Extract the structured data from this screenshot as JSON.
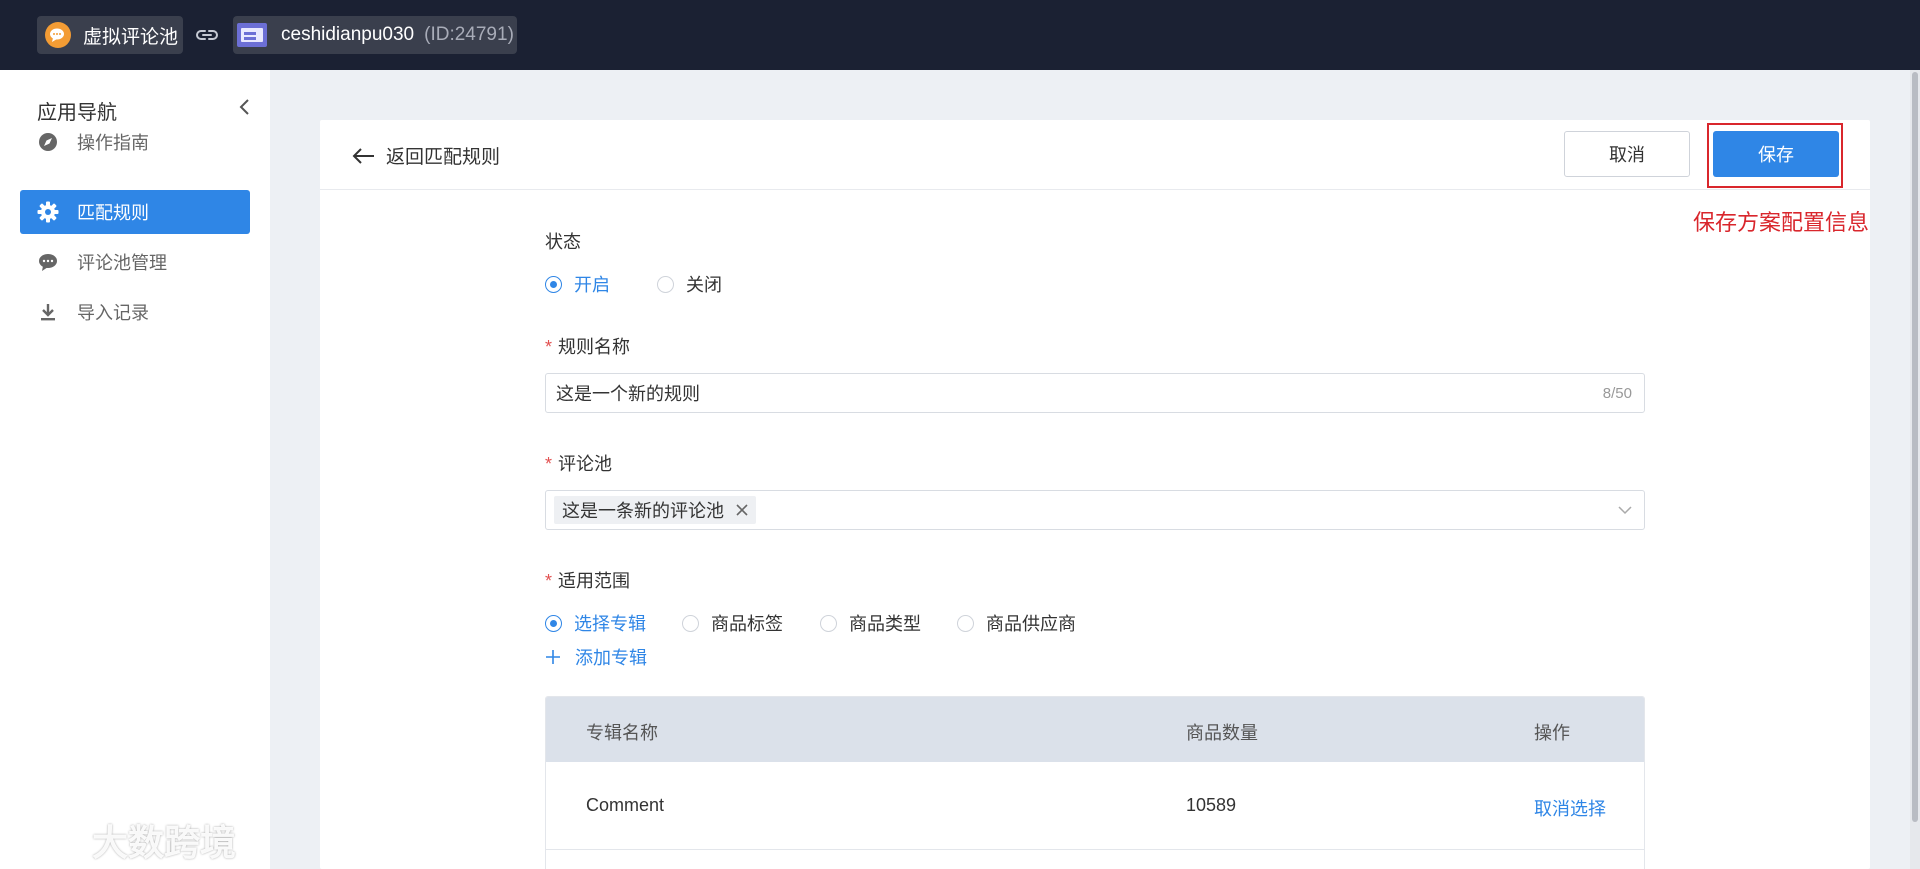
{
  "topbar": {
    "app_name": "虚拟评论池",
    "shop_name": "ceshidianpu030",
    "shop_id": "(ID:24791)"
  },
  "sidebar": {
    "title": "应用导航",
    "items": [
      {
        "label": "操作指南",
        "icon": "compass-icon",
        "active": false
      },
      {
        "label": "匹配规则",
        "icon": "gear-icon",
        "active": true
      },
      {
        "label": "评论池管理",
        "icon": "chat-icon",
        "active": false
      },
      {
        "label": "导入记录",
        "icon": "download-icon",
        "active": false
      }
    ]
  },
  "header": {
    "back_label": "返回匹配规则",
    "cancel_label": "取消",
    "save_label": "保存",
    "annotation": "保存方案配置信息"
  },
  "form": {
    "status": {
      "label": "状态",
      "options": [
        "开启",
        "关闭"
      ],
      "selected": "开启"
    },
    "rule_name": {
      "label": "规则名称",
      "value": "这是一个新的规则",
      "counter": "8/50"
    },
    "comment_pool": {
      "label": "评论池",
      "tags": [
        "这是一条新的评论池"
      ]
    },
    "scope": {
      "label": "适用范围",
      "options": [
        "选择专辑",
        "商品标签",
        "商品类型",
        "商品供应商"
      ],
      "selected": "选择专辑",
      "add_label": "添加专辑"
    }
  },
  "table": {
    "headers": [
      "专辑名称",
      "商品数量",
      "操作"
    ],
    "rows": [
      {
        "name": "Comment",
        "count": "10589",
        "action": "取消选择"
      }
    ]
  },
  "colors": {
    "primary": "#2f86e6",
    "topbar": "#1b2133",
    "annotation": "#d9262c"
  },
  "watermark": {
    "text": "大数跨境"
  }
}
